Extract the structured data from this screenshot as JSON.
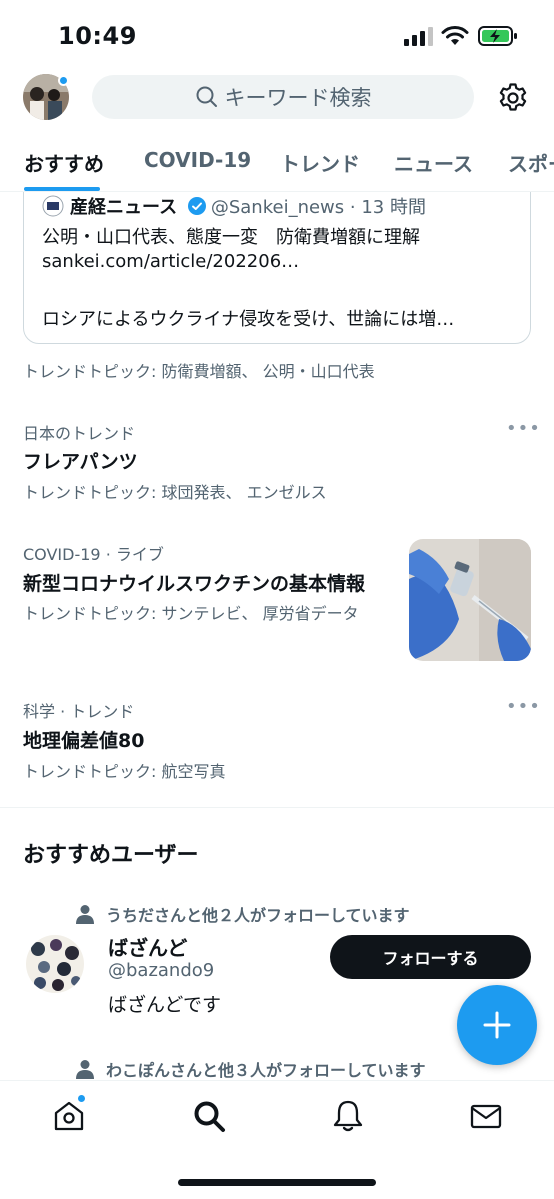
{
  "status_bar": {
    "time": "10:49"
  },
  "header": {
    "search_placeholder": "キーワード検索"
  },
  "tabs": [
    {
      "label": "おすすめ",
      "active": true
    },
    {
      "label": "COVID-19",
      "active": false
    },
    {
      "label": "トレンド",
      "active": false
    },
    {
      "label": "ニュース",
      "active": false
    },
    {
      "label": "スポー",
      "active": false
    }
  ],
  "news_card": {
    "source_name": "産経ニュース",
    "source_handle": "@Sankei_news · 13 時間",
    "headline": "公明・山口代表、態度一変　防衛費増額に理解",
    "link": "sankei.com/article/202206…",
    "body": "ロシアによるウクライナ侵攻を受け、世論には増…"
  },
  "trends": [
    {
      "meta": "",
      "title": "",
      "topics": "トレンドトピック: 防衛費増額、 公明・山口代表"
    },
    {
      "meta": "日本のトレンド",
      "title": "フレアパンツ",
      "topics": "トレンドトピック: 球団発表、 エンゼルス"
    },
    {
      "meta": "COVID-19 · ライブ",
      "title": "新型コロナウイルスワクチンの基本情報",
      "topics": "トレンドトピック: サンテレビ、 厚労省データ"
    },
    {
      "meta": "科学 · トレンド",
      "title": "地理偏差値80",
      "topics": "トレンドトピック: 航空写真"
    }
  ],
  "recommended": {
    "section_title": "おすすめユーザー",
    "users": [
      {
        "social_context": "うちださんと他２人がフォローしています",
        "name": "ばざんど",
        "handle": "@bazando9",
        "bio": "ばざんどです",
        "follow_label": "フォローする"
      },
      {
        "social_context": "わこぽんさんと他３人がフォローしています"
      }
    ]
  },
  "colors": {
    "accent": "#1d9bf0",
    "text": "#0f1419",
    "secondary": "#536471",
    "follow_bg": "#0f1419"
  },
  "icons": [
    "search-icon",
    "gear-icon",
    "verified-icon",
    "person-icon",
    "plus-icon",
    "home-icon",
    "explore-icon",
    "bell-icon",
    "mail-icon"
  ]
}
